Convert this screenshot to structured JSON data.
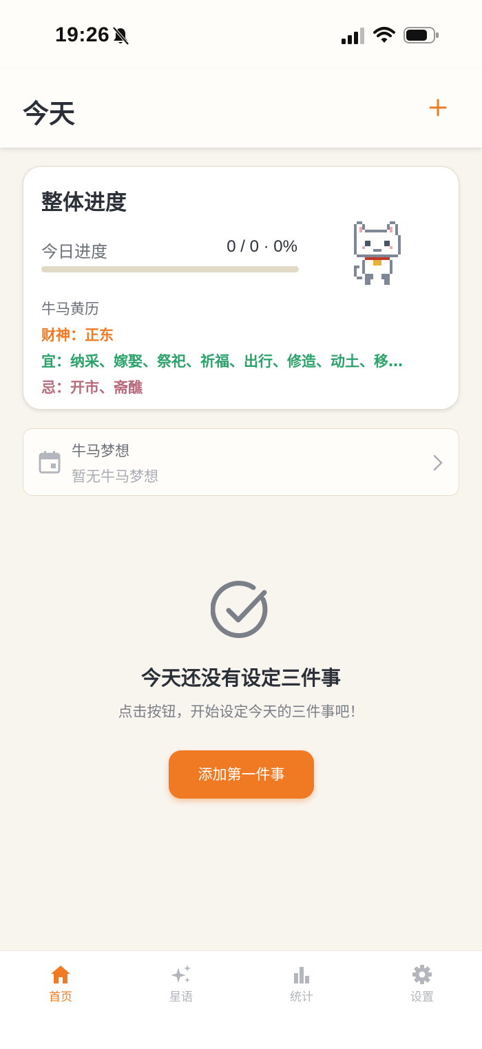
{
  "status_bar": {
    "time": "19:26",
    "icons": [
      "bell-slash-icon",
      "signal-icon",
      "wifi-icon",
      "battery-icon"
    ]
  },
  "header": {
    "title": "今天",
    "add_icon": "plus-icon"
  },
  "progress_card": {
    "title": "整体进度",
    "progress_label": "今日进度",
    "progress_value": "0 / 0 · 0%",
    "progress_fraction": 0,
    "mascot": "pixel-cat-icon",
    "almanac": {
      "title": "牛马黄历",
      "wealth": "财神：正东",
      "good": "宜：纳采、嫁娶、祭祀、祈福、出行、修造、动土、移…",
      "bad": "忌：开市、斋醮"
    }
  },
  "dream_card": {
    "title": "牛马梦想",
    "subtitle": "暂无牛马梦想",
    "icon": "calendar-icon"
  },
  "empty_state": {
    "icon": "check-circle-icon",
    "title": "今天还没有设定三件事",
    "description": "点击按钮，开始设定今天的三件事吧！",
    "button_label": "添加第一件事"
  },
  "tab_bar": {
    "items": [
      {
        "label": "首页",
        "icon": "home-icon",
        "active": true
      },
      {
        "label": "星语",
        "icon": "sparkle-icon",
        "active": false
      },
      {
        "label": "统计",
        "icon": "bar-chart-icon",
        "active": false
      },
      {
        "label": "设置",
        "icon": "gear-icon",
        "active": false
      }
    ]
  },
  "colors": {
    "accent": "#f07a24",
    "good": "#2aa26a",
    "bad": "#b86a7c",
    "background": "#f8f4ee"
  }
}
